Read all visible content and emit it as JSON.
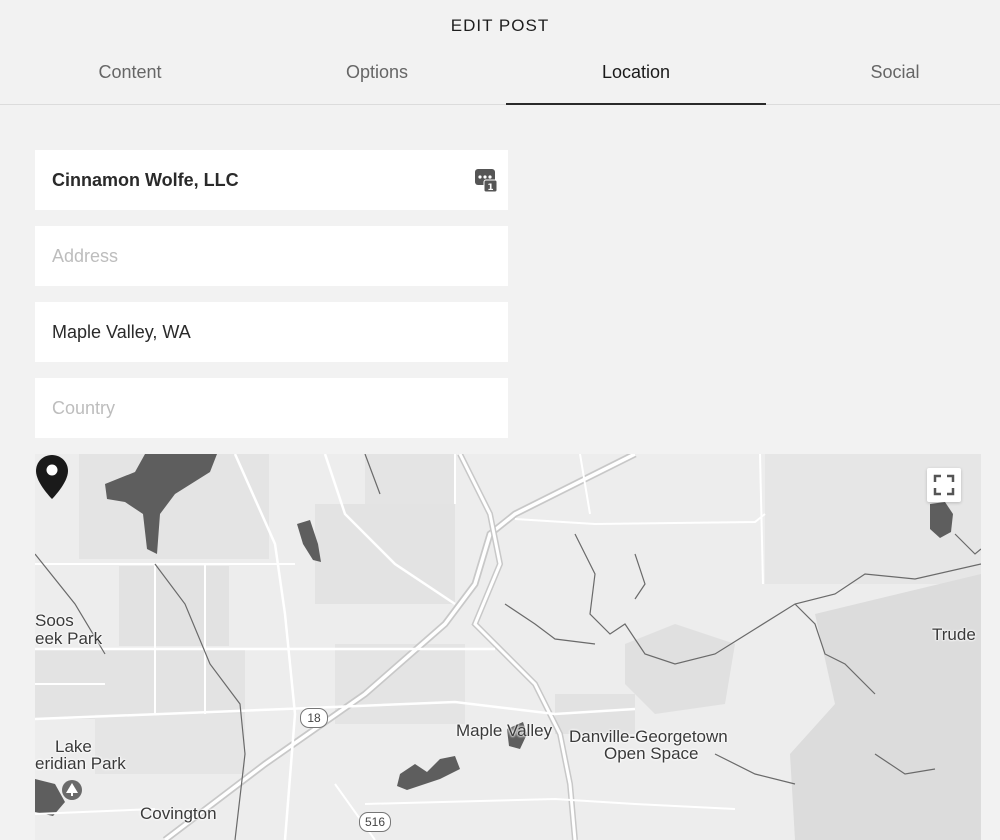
{
  "header": {
    "title": "EDIT POST"
  },
  "tabs": [
    {
      "label": "Content"
    },
    {
      "label": "Options"
    },
    {
      "label": "Location",
      "active": true
    },
    {
      "label": "Social"
    }
  ],
  "fields": {
    "name": {
      "value": "Cinnamon Wolfe, LLC",
      "icon": "password-manager-icon",
      "badge": "1"
    },
    "address": {
      "value": "",
      "placeholder": "Address"
    },
    "city": {
      "value": "Maple Valley, WA"
    },
    "country": {
      "value": "",
      "placeholder": "Country"
    }
  },
  "map": {
    "labels": {
      "soos_1": "Soos",
      "soos_2": "eek Park",
      "lake_1": "Lake",
      "lake_2": "eridian Park",
      "covington": "Covington",
      "maple_valley": "Maple Valley",
      "danville_1": "Danville-Georgetown",
      "danville_2": "Open Space",
      "trude": "Trude"
    },
    "shields": {
      "route_18": "18",
      "route_516": "516"
    },
    "fullscreen_icon": "fullscreen-icon",
    "marker_icon": "map-pin-icon",
    "park_icon": "tree-icon"
  }
}
